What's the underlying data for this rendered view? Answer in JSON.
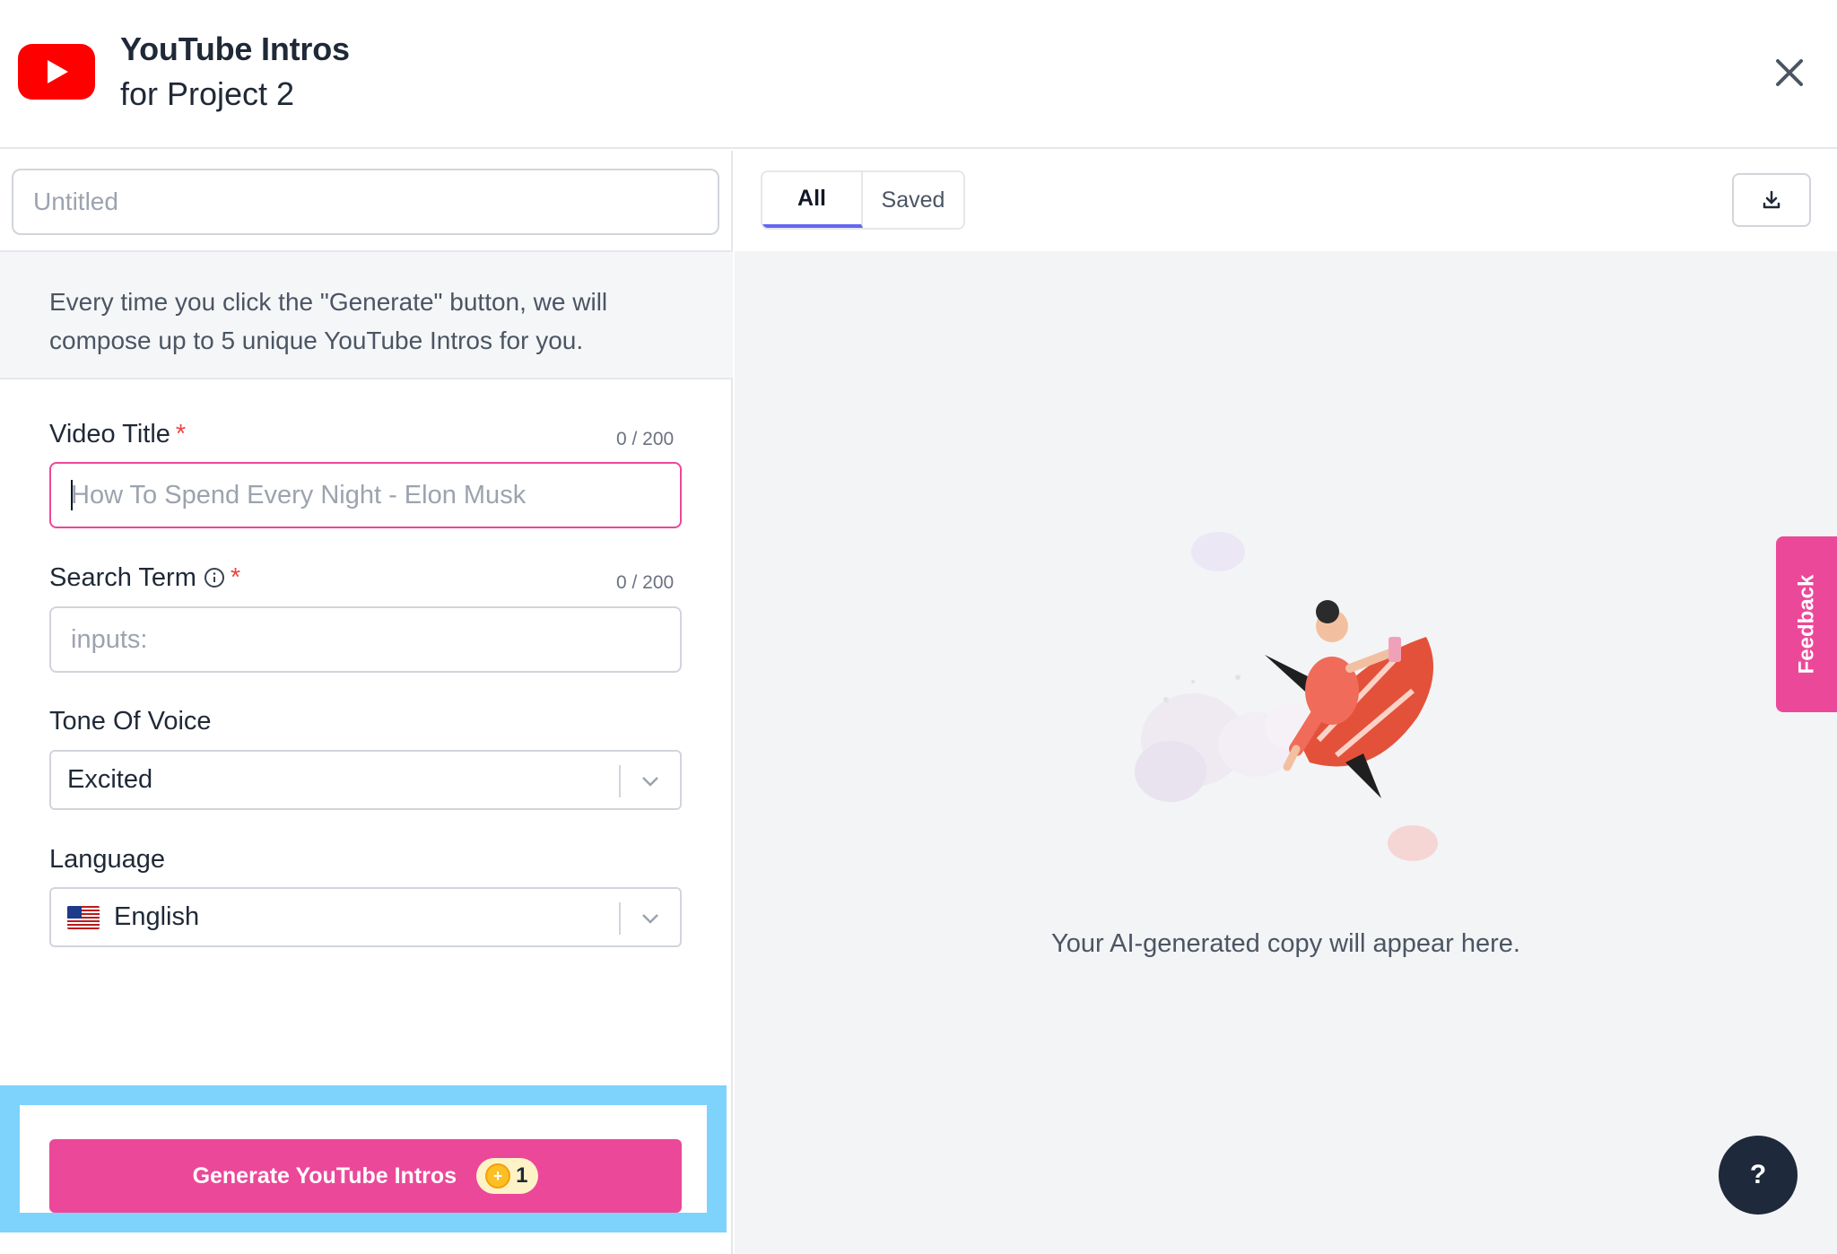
{
  "header": {
    "title": "YouTube Intros",
    "subtitle": "for Project 2",
    "logo_icon": "youtube-logo-icon",
    "close_icon": "close-icon"
  },
  "form": {
    "doc_title_placeholder": "Untitled",
    "info_text": "Every time you click the \"Generate\" button, we will compose up to 5 unique YouTube Intros for you.",
    "video_title": {
      "label": "Video Title",
      "required": "*",
      "counter": "0 / 200",
      "value": "",
      "placeholder": "How To Spend Every Night - Elon Musk"
    },
    "search_term": {
      "label": "Search Term",
      "required": "*",
      "counter": "0 / 200",
      "value": "",
      "placeholder": "inputs:"
    },
    "tone": {
      "label": "Tone Of Voice",
      "selected": "Excited"
    },
    "language": {
      "label": "Language",
      "selected": "English",
      "flag_icon": "us-flag-icon"
    },
    "generate": {
      "label": "Generate YouTube Intros",
      "credit_count": "1"
    }
  },
  "results": {
    "tabs": [
      {
        "label": "All",
        "active": true
      },
      {
        "label": "Saved",
        "active": false
      }
    ],
    "empty_text": "Your AI-generated copy will appear here."
  },
  "feedback_label": "Feedback",
  "help_label": "?",
  "colors": {
    "accent": "#ec4899",
    "tab_indicator": "#6366f1",
    "highlight": "#7dd3fc",
    "youtube_red": "#ff0000"
  }
}
